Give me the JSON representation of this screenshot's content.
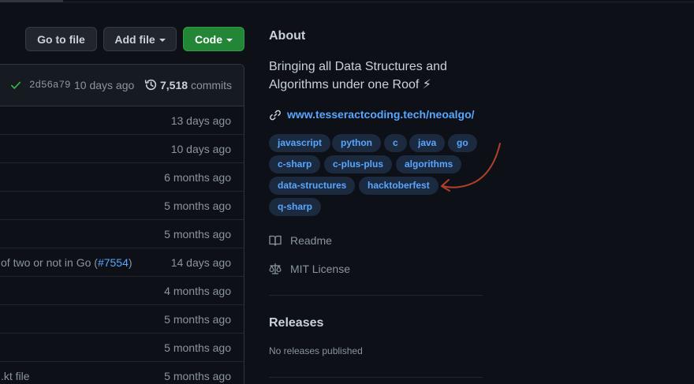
{
  "toolbar": {
    "go_to_file": "Go to file",
    "add_file": "Add file",
    "code": "Code"
  },
  "commit": {
    "sha": "2d56a79",
    "age": "10 days ago",
    "count": "7,518",
    "count_label": "commits"
  },
  "files": [
    {
      "message": "",
      "age": "13 days ago"
    },
    {
      "message": "",
      "age": "10 days ago"
    },
    {
      "message": "",
      "age": "6 months ago"
    },
    {
      "message": "",
      "age": "5 months ago"
    },
    {
      "message": "",
      "age": "5 months ago"
    },
    {
      "message": "of two or not in Go (",
      "link": "#7554",
      "message_suffix": ")",
      "age": "14 days ago"
    },
    {
      "message": "",
      "age": "4 months ago"
    },
    {
      "message": "",
      "age": "5 months ago"
    },
    {
      "message": "",
      "age": "5 months ago"
    },
    {
      "message": ".kt file",
      "age": "5 months ago"
    }
  ],
  "about": {
    "title": "About",
    "description_line1": "Bringing all Data Structures and",
    "description_line2": "Algorithms under one Roof ⚡",
    "website": "www.tesseractcoding.tech/neoalgo/",
    "topics": [
      "javascript",
      "python",
      "c",
      "java",
      "go",
      "c-sharp",
      "c-plus-plus",
      "algorithms",
      "data-structures",
      "hacktoberfest",
      "q-sharp"
    ],
    "readme": "Readme",
    "license": "MIT License"
  },
  "releases": {
    "title": "Releases",
    "empty": "No releases published"
  },
  "icons": {
    "check": "check-icon",
    "history": "history-icon",
    "link": "link-icon",
    "book": "book-icon",
    "law": "law-icon"
  },
  "colors": {
    "background": "#0d1117",
    "link": "#58a6ff",
    "code_button": "#238636",
    "topic_bg": "#1c2a40",
    "annotation": "#b0402a"
  }
}
